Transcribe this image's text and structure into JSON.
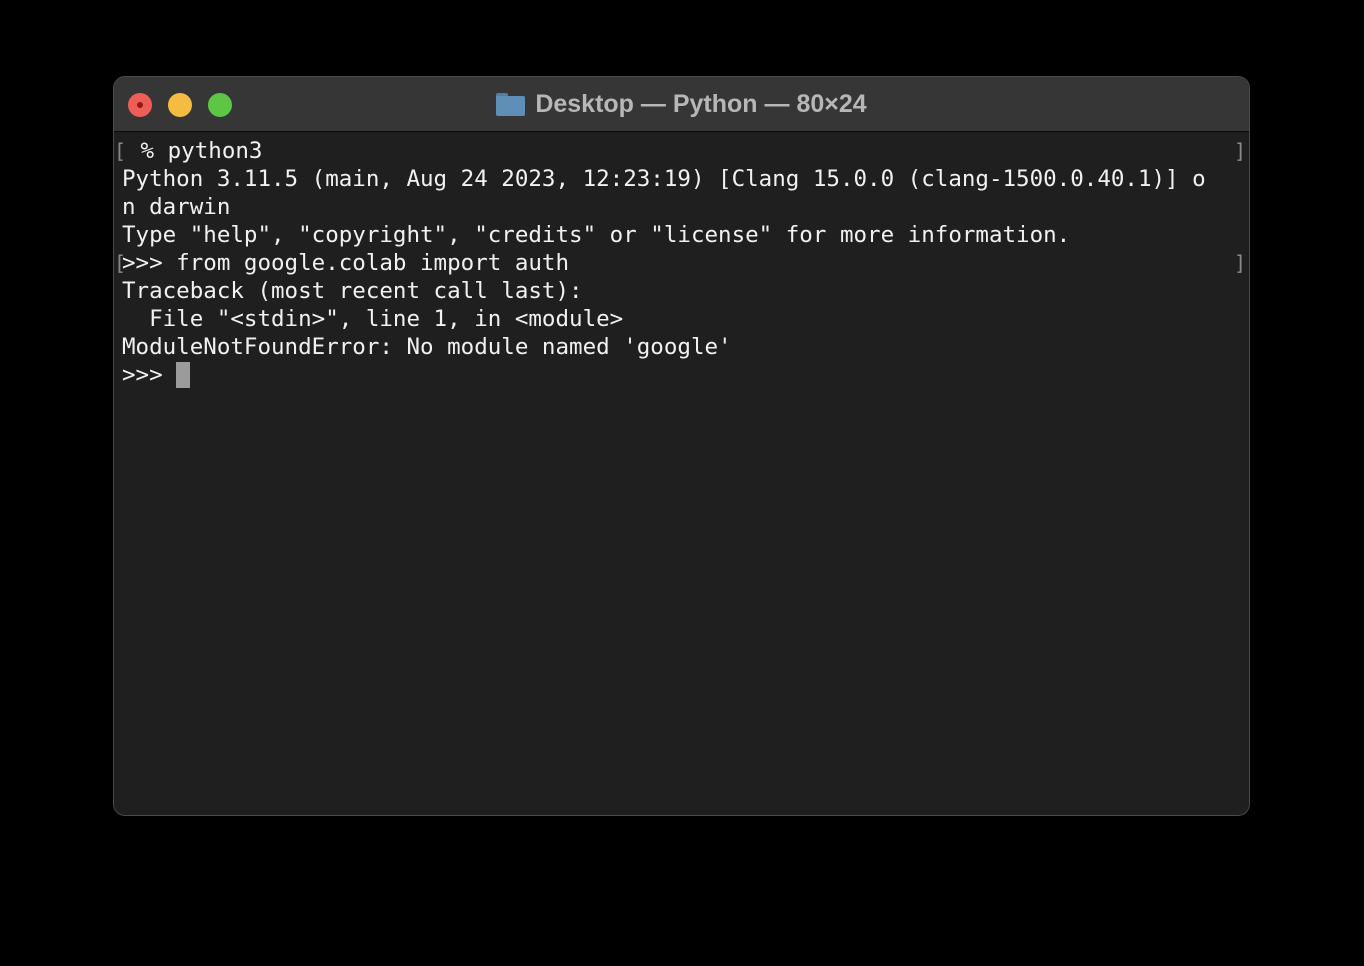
{
  "window": {
    "title": "Desktop — Python — 80×24",
    "title_icon": "folder-icon",
    "traffic_lights": {
      "close": "#ee5e57",
      "minimize": "#f4bd41",
      "zoom": "#5ec645"
    }
  },
  "terminal": {
    "lines": [
      " % python3",
      "Python 3.11.5 (main, Aug 24 2023, 12:23:19) [Clang 15.0.0 (clang-1500.0.40.1)] o",
      "n darwin",
      "Type \"help\", \"copyright\", \"credits\" or \"license\" for more information.",
      ">>> from google.colab import auth",
      "Traceback (most recent call last):",
      "  File \"<stdin>\", line 1, in <module>",
      "ModuleNotFoundError: No module named 'google'"
    ],
    "prompt": ">>> ",
    "mark_open": "[",
    "mark_close": "]"
  }
}
